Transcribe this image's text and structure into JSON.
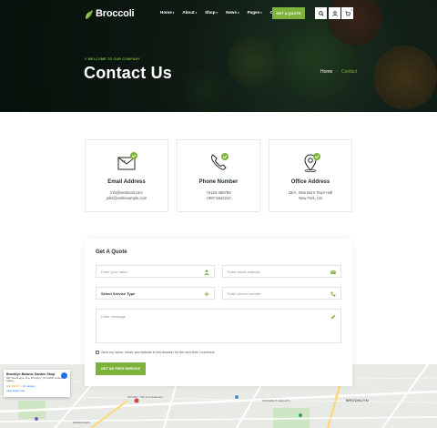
{
  "brand": {
    "name": "Broccoli",
    "accent": "#7eb33b",
    "dark": "#0d1a12"
  },
  "nav": {
    "items": [
      {
        "label": "Home",
        "caret": "▾"
      },
      {
        "label": "About",
        "caret": "▾"
      },
      {
        "label": "Shop",
        "caret": "▾"
      },
      {
        "label": "News",
        "caret": "▾"
      },
      {
        "label": "Pages",
        "caret": "▾"
      },
      {
        "label": "Contact",
        "caret": ""
      }
    ],
    "cta": "GET A QUOTE",
    "icons": [
      "search-icon",
      "user-icon",
      "cart-icon"
    ],
    "cart_count": "0"
  },
  "hero": {
    "eyebrow": "// WELCOME TO OUR COMPANY",
    "title": "Contact Us",
    "breadcrumb": {
      "home": "Home",
      "separator": "-",
      "current": "Contact"
    }
  },
  "contact_cards": [
    {
      "icon": "envelope-icon",
      "title": "Email Address",
      "lines": [
        "info@webmail.com",
        "jobs@webexample.com"
      ]
    },
    {
      "icon": "phone-icon",
      "title": "Phone Number",
      "lines": [
        "+0123-456789",
        "+987-6543210"
      ]
    },
    {
      "icon": "location-pin-icon",
      "title": "Office Address",
      "lines": [
        "18/A, New Born Town Hall",
        "New York, US"
      ]
    }
  ],
  "form": {
    "title": "Get A Quote",
    "name_placeholder": "Enter your name",
    "email_placeholder": "Enter email address",
    "service_select": "Select Service Type",
    "phone_placeholder": "Enter phone number",
    "message_placeholder": "Enter message",
    "consent": "Save my name, email, and website in this browser for the next time I comment.",
    "submit": "GET AN FREE SERVICE"
  },
  "map": {
    "place_name": "Brooklyn Botanic Garden Shop",
    "address": "990 Washington Ave, Brooklyn, NY 11225, United States",
    "rating": "4.4",
    "stars": "★★★★☆",
    "reviews": "20 reviews",
    "view_larger": "View larger map",
    "labels": [
      "BROOKLYN",
      "PROSPECT HEIGHTS",
      "DOWNTOWN",
      "Gift Mart - Gift and Stationery"
    ]
  }
}
